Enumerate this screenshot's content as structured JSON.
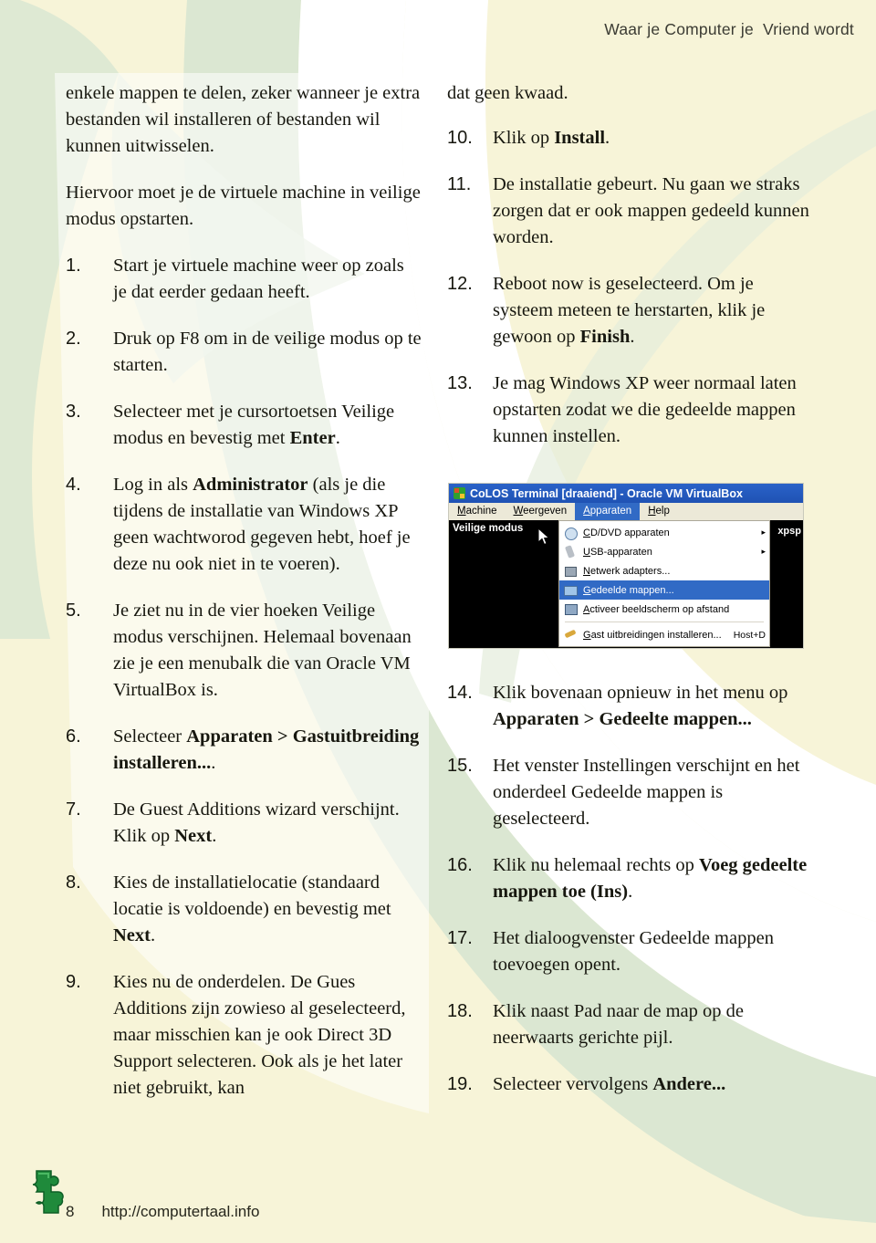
{
  "header": {
    "title": "Waar je Computer je  Vriend wordt"
  },
  "colors": {
    "page_bg": "#f7f4d8",
    "green_band": "#d4e3cd",
    "white_area": "#ffffff",
    "title_bar_blue": "#2a62c8",
    "menu_highlight": "#316ac5",
    "logo_green": "#1f8a3b"
  },
  "left_column": {
    "intro_paragraph_1": "enkele mappen te delen, zeker wanneer je extra bestanden wil installeren of bestanden wil kunnen uitwisselen.",
    "intro_paragraph_2": "Hiervoor moet je de virtuele machine in veilige modus opstarten.",
    "steps": [
      {
        "num": "1.",
        "html": "Start je virtuele machine weer op zoals je dat eerder gedaan heeft."
      },
      {
        "num": "2.",
        "html": "Druk op F8 om in de veilige modus op te starten."
      },
      {
        "num": "3.",
        "html": "Selecteer met je cursortoetsen Veilige modus en bevestig met <b>Enter</b>."
      },
      {
        "num": "4.",
        "html": "Log in als <b>Administrator</b> (als je die tijdens de installatie van Windows XP geen wachtworod gegeven hebt, hoef je deze nu ook niet in te voeren)."
      },
      {
        "num": "5.",
        "html": "Je ziet nu in de vier hoeken Veilige modus verschijnen. Helemaal bovenaan zie je een menubalk die van Oracle VM VirtualBox is."
      },
      {
        "num": "6.",
        "html": "Selecteer <b>Apparaten &gt; Gastuitbreiding installeren...</b>."
      },
      {
        "num": "7.",
        "html": "De Guest Additions wizard verschijnt. Klik op <b>Next</b>."
      },
      {
        "num": "8.",
        "html": "Kies de installatielocatie (standaard locatie is voldoende) en bevestig met <b>Next</b>."
      },
      {
        "num": "9.",
        "html": "Kies nu de onderdelen. De Gues Additions zijn zowieso al geselecteerd, maar misschien kan je ook Direct 3D Support selecteren. Ook als je het later niet gebruikt, kan"
      }
    ]
  },
  "right_column": {
    "continuation_text": "dat geen kwaad.",
    "steps_top": [
      {
        "num": "10.",
        "html": "Klik op <b>Install</b>."
      },
      {
        "num": "11.",
        "html": "De installatie gebeurt. Nu gaan we straks zorgen dat er ook mappen gedeeld kunnen worden."
      },
      {
        "num": "12.",
        "html": "Reboot now is geselecteerd. Om je systeem meteen te herstarten, klik je gewoon op <b>Finish</b>."
      },
      {
        "num": "13.",
        "html": "Je mag Windows XP weer normaal laten opstarten zodat we die gedeelde mappen kunnen instellen."
      }
    ],
    "steps_bottom": [
      {
        "num": "14.",
        "html": "Klik bovenaan opnieuw in het menu op  <b>Apparaten &gt; Gedeelte mappen...</b>"
      },
      {
        "num": "15.",
        "html": "Het venster Instellingen verschijnt en het onderdeel Gedeelde mappen is geselecteerd."
      },
      {
        "num": "16.",
        "html": "Klik nu helemaal rechts op <b>Voeg gedeelte mappen toe (Ins)</b>."
      },
      {
        "num": "17.",
        "html": "Het dialoogvenster Gedeelde mappen toevoegen opent."
      },
      {
        "num": "18.",
        "html": "Klik naast Pad naar de map op de neerwaarts gerichte pijl."
      },
      {
        "num": "19.",
        "html": "Selecteer vervolgens <b>Andere...</b>"
      }
    ]
  },
  "vbox_screenshot": {
    "window_title": "CoLOS Terminal [draaiend] - Oracle VM VirtualBox",
    "menubar": [
      {
        "label": "Machine",
        "accel": "M",
        "active": false
      },
      {
        "label": "Weergeven",
        "accel": "W",
        "active": false
      },
      {
        "label": "Apparaten",
        "accel": "A",
        "active": true
      },
      {
        "label": "Help",
        "accel": "H",
        "active": false
      }
    ],
    "vm_corner_label": "Veilige modus",
    "vm_right_label": "xpsp",
    "dropdown_items": [
      {
        "label": "CD/DVD apparaten",
        "icon": "cd-icon",
        "submenu": "▸",
        "accel": "",
        "selected": false
      },
      {
        "label": "USB-apparaten",
        "icon": "usb-icon",
        "submenu": "▸",
        "accel": "",
        "selected": false
      },
      {
        "label": "Netwerk adapters...",
        "icon": "network-icon",
        "submenu": "",
        "accel": "",
        "selected": false
      },
      {
        "label": "Gedeelde mappen...",
        "icon": "shared-folder-icon",
        "submenu": "",
        "accel": "",
        "selected": true
      },
      {
        "label": "Activeer beeldscherm op afstand",
        "icon": "remote-display-icon",
        "submenu": "",
        "accel": "",
        "selected": false
      },
      {
        "label": "Gast uitbreidingen installeren...",
        "icon": "guest-additions-icon",
        "submenu": "",
        "accel": "Host+D",
        "selected": false
      }
    ]
  },
  "footer": {
    "page_number": "8",
    "url": "http://computertaal.info"
  }
}
